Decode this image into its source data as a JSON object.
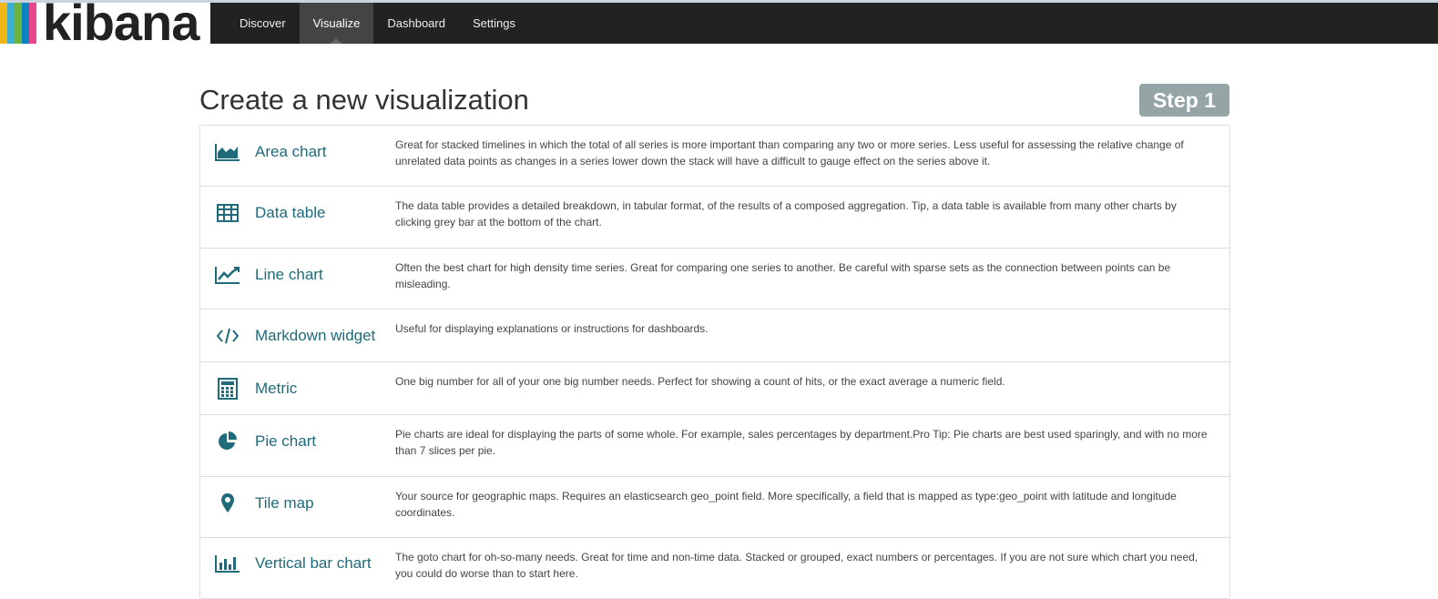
{
  "app": {
    "brand": "kibana",
    "brand_colors": [
      "#e8478b",
      "#3caed2",
      "#f3b619",
      "#6db33f",
      "#0a83c1"
    ],
    "nav": [
      {
        "label": "Discover",
        "active": false
      },
      {
        "label": "Visualize",
        "active": true
      },
      {
        "label": "Dashboard",
        "active": false
      },
      {
        "label": "Settings",
        "active": false
      }
    ]
  },
  "page": {
    "title": "Create a new visualization",
    "step": "Step 1"
  },
  "visualizations": [
    {
      "name": "Area chart",
      "icon": "area-chart-icon",
      "description": "Great for stacked timelines in which the total of all series is more important than comparing any two or more series. Less useful for assessing the relative change of unrelated data points as changes in a series lower down the stack will have a difficult to gauge effect on the series above it."
    },
    {
      "name": "Data table",
      "icon": "table-icon",
      "description": "The data table provides a detailed breakdown, in tabular format, of the results of a composed aggregation. Tip, a data table is available from many other charts by clicking grey bar at the bottom of the chart."
    },
    {
      "name": "Line chart",
      "icon": "line-chart-icon",
      "description": "Often the best chart for high density time series. Great for comparing one series to another. Be careful with sparse sets as the connection between points can be misleading."
    },
    {
      "name": "Markdown widget",
      "icon": "code-icon",
      "description": "Useful for displaying explanations or instructions for dashboards."
    },
    {
      "name": "Metric",
      "icon": "calculator-icon",
      "description": "One big number for all of your one big number needs. Perfect for showing a count of hits, or the exact average a numeric field."
    },
    {
      "name": "Pie chart",
      "icon": "pie-chart-icon",
      "description": "Pie charts are ideal for displaying the parts of some whole. For example, sales percentages by department.Pro Tip: Pie charts are best used sparingly, and with no more than 7 slices per pie."
    },
    {
      "name": "Tile map",
      "icon": "map-marker-icon",
      "description": "Your source for geographic maps. Requires an elasticsearch geo_point field. More specifically, a field that is mapped as type:geo_point with latitude and longitude coordinates."
    },
    {
      "name": "Vertical bar chart",
      "icon": "bar-chart-icon",
      "description": "The goto chart for oh-so-many needs. Great for time and non-time data. Stacked or grouped, exact numbers or percentages. If you are not sure which chart you need, you could do worse than to start here."
    }
  ]
}
